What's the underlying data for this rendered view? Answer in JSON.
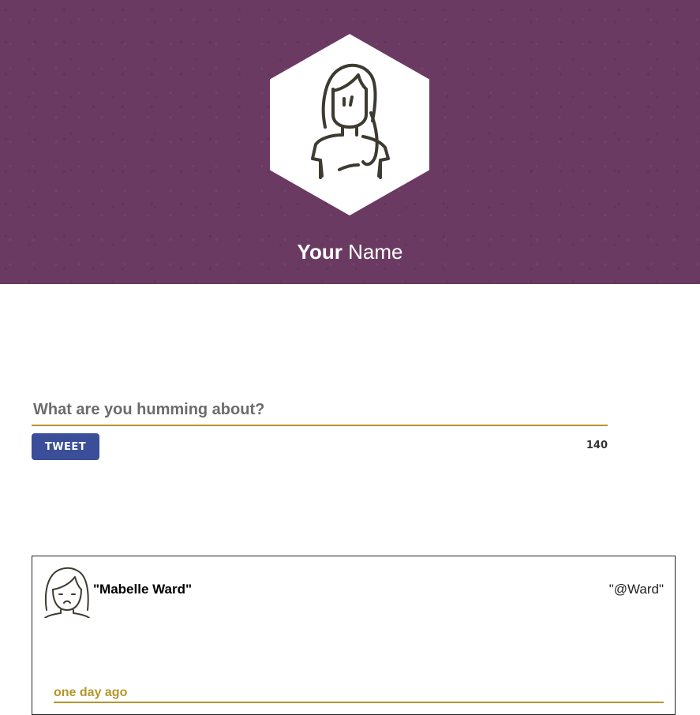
{
  "profile": {
    "name_first": "Your",
    "name_last": "Name",
    "avatar_icon": "woman-avatar-icon"
  },
  "compose": {
    "placeholder": "What are you humming about?",
    "value": "",
    "button_label": "TWEET",
    "char_count": "140"
  },
  "tweets": [
    {
      "name": "\"Mabelle Ward\"",
      "handle": "\"@Ward\"",
      "time": "one day ago",
      "avatar_icon": "frowning-woman-avatar-icon"
    }
  ],
  "colors": {
    "header_bg": "#6a3a62",
    "accent_gold": "#b5952a",
    "button_blue": "#3a4e99"
  }
}
